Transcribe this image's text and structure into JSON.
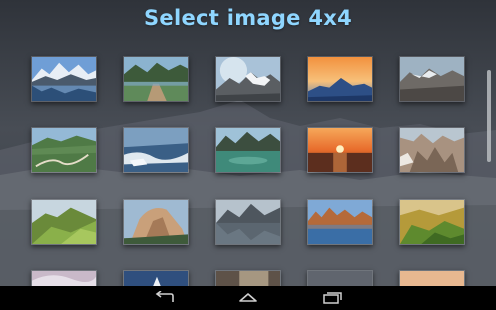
{
  "header": {
    "title": "Select image 4x4"
  },
  "gallery": {
    "rows": [
      [
        {
          "scene": "snowy-mountain-lake"
        },
        {
          "scene": "wooden-dock-lake"
        },
        {
          "scene": "mountain-glacier-sky"
        },
        {
          "scene": "sunset-mountain-silhouette"
        },
        {
          "scene": "rocky-mountain-ridge"
        }
      ],
      [
        {
          "scene": "winding-mountain-road"
        },
        {
          "scene": "icy-coast-waves"
        },
        {
          "scene": "green-lake-mountains"
        },
        {
          "scene": "sunset-over-sea"
        },
        {
          "scene": "rocky-canyon"
        }
      ],
      [
        {
          "scene": "green-hill-slopes"
        },
        {
          "scene": "granite-dome-cliff"
        },
        {
          "scene": "misty-mountain-lake"
        },
        {
          "scene": "rock-formations-lake"
        },
        {
          "scene": "green-valley-hills"
        }
      ],
      [
        {
          "scene": "partial-sky-1"
        },
        {
          "scene": "partial-sky-2"
        },
        {
          "scene": "partial-sky-3"
        },
        {
          "scene": "partial-sky-4"
        },
        {
          "scene": "partial-sky-5"
        }
      ]
    ]
  },
  "navbar": {
    "back_icon": "back-arrow-icon",
    "home_icon": "home-icon",
    "recents_icon": "recent-apps-icon"
  },
  "colors": {
    "title": "#8fd6ff",
    "navbar": "#000000",
    "backdrop": "#3d4149"
  }
}
